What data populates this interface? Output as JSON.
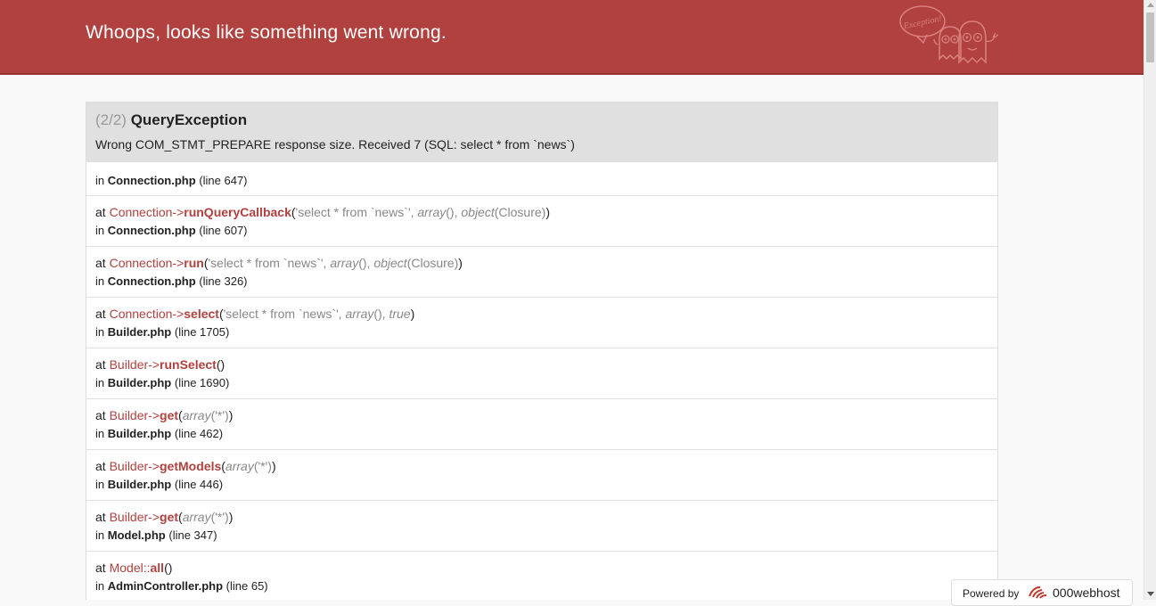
{
  "header": {
    "title": "Whoops, looks like something went wrong.",
    "logo_text": "Exception!"
  },
  "exception": {
    "count": "(2/2)",
    "name": "QueryException",
    "message": "Wrong COM_STMT_PREPARE response size. Received 7 (SQL: select * from `news`)",
    "origin": {
      "file": "Connection.php",
      "line": "(line 647)"
    }
  },
  "trace": [
    {
      "class": "Connection",
      "op": "->",
      "fn": "runQueryCallback",
      "open": "(",
      "args": [
        {
          "text": "'select * from `news`'",
          "italic": false
        },
        {
          "text": ", ",
          "italic": false
        },
        {
          "text": "array",
          "italic": true
        },
        {
          "text": "(), ",
          "italic": false
        },
        {
          "text": "object",
          "italic": true
        },
        {
          "text": "(Closure)",
          "italic": false
        }
      ],
      "close": ")",
      "file": "Connection.php",
      "line": "(line 607)"
    },
    {
      "class": "Connection",
      "op": "->",
      "fn": "run",
      "open": "(",
      "args": [
        {
          "text": "'select * from `news`'",
          "italic": false
        },
        {
          "text": ", ",
          "italic": false
        },
        {
          "text": "array",
          "italic": true
        },
        {
          "text": "(), ",
          "italic": false
        },
        {
          "text": "object",
          "italic": true
        },
        {
          "text": "(Closure)",
          "italic": false
        }
      ],
      "close": ")",
      "file": "Connection.php",
      "line": "(line 326)"
    },
    {
      "class": "Connection",
      "op": "->",
      "fn": "select",
      "open": "(",
      "args": [
        {
          "text": "'select * from `news`'",
          "italic": false
        },
        {
          "text": ", ",
          "italic": false
        },
        {
          "text": "array",
          "italic": true
        },
        {
          "text": "(), ",
          "italic": false
        },
        {
          "text": "true",
          "italic": true
        }
      ],
      "close": ")",
      "file": "Builder.php",
      "line": "(line 1705)"
    },
    {
      "class": "Builder",
      "op": "->",
      "fn": "runSelect",
      "open": "(",
      "args": [],
      "close": ")",
      "file": "Builder.php",
      "line": "(line 1690)"
    },
    {
      "class": "Builder",
      "op": "->",
      "fn": "get",
      "open": "(",
      "args": [
        {
          "text": "array",
          "italic": true
        },
        {
          "text": "('*')",
          "italic": false
        }
      ],
      "close": ")",
      "file": "Builder.php",
      "line": "(line 462)"
    },
    {
      "class": "Builder",
      "op": "->",
      "fn": "getModels",
      "open": "(",
      "args": [
        {
          "text": "array",
          "italic": true
        },
        {
          "text": "('*')",
          "italic": false
        }
      ],
      "close": ")",
      "file": "Builder.php",
      "line": "(line 446)"
    },
    {
      "class": "Builder",
      "op": "->",
      "fn": "get",
      "open": "(",
      "args": [
        {
          "text": "array",
          "italic": true
        },
        {
          "text": "('*')",
          "italic": false
        }
      ],
      "close": ")",
      "file": "Model.php",
      "line": "(line 347)"
    },
    {
      "class": "Model",
      "op": "::",
      "fn": "all",
      "open": "(",
      "args": [],
      "close": ")",
      "file": "AdminController.php",
      "line": "(line 65)"
    }
  ],
  "labels": {
    "at": "at",
    "in": "in"
  },
  "footer": {
    "powered_label": "Powered by",
    "host_name": "000webhost"
  },
  "colors": {
    "header_bg": "#b0413e",
    "accent": "#b0413e",
    "panel_head_bg": "#e0e0e0",
    "muted": "#888888"
  }
}
